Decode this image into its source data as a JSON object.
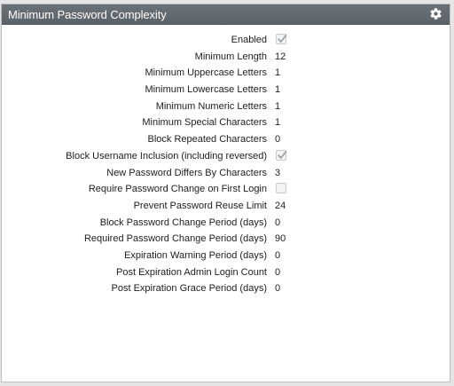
{
  "panel": {
    "title": "Minimum Password Complexity",
    "settings_icon": "gear-icon"
  },
  "settings": [
    {
      "key": "enabled",
      "label": "Enabled",
      "type": "checkbox",
      "checked": true,
      "disabled": true
    },
    {
      "key": "min-length",
      "label": "Minimum Length",
      "type": "value",
      "value": "12"
    },
    {
      "key": "min-uppercase",
      "label": "Minimum Uppercase Letters",
      "type": "value",
      "value": "1"
    },
    {
      "key": "min-lowercase",
      "label": "Minimum Lowercase Letters",
      "type": "value",
      "value": "1"
    },
    {
      "key": "min-numeric",
      "label": "Minimum Numeric Letters",
      "type": "value",
      "value": "1"
    },
    {
      "key": "min-special",
      "label": "Minimum Special Characters",
      "type": "value",
      "value": "1"
    },
    {
      "key": "block-repeated",
      "label": "Block Repeated Characters",
      "type": "value",
      "value": "0"
    },
    {
      "key": "block-username",
      "label": "Block Username Inclusion (including reversed)",
      "type": "checkbox",
      "checked": true,
      "disabled": true
    },
    {
      "key": "new-differs",
      "label": "New Password Differs By Characters",
      "type": "value",
      "value": "3"
    },
    {
      "key": "require-change-first-login",
      "label": "Require Password Change on First Login",
      "type": "checkbox",
      "checked": false,
      "disabled": true
    },
    {
      "key": "reuse-limit",
      "label": "Prevent Password Reuse Limit",
      "type": "value",
      "value": "24"
    },
    {
      "key": "block-change-period",
      "label": "Block Password Change Period (days)",
      "type": "value",
      "value": "0"
    },
    {
      "key": "required-change-period",
      "label": "Required Password Change Period (days)",
      "type": "value",
      "value": "90"
    },
    {
      "key": "expiration-warning",
      "label": "Expiration Warning Period (days)",
      "type": "value",
      "value": "0"
    },
    {
      "key": "post-expiration-admin-login",
      "label": "Post Expiration Admin Login Count",
      "type": "value",
      "value": "0"
    },
    {
      "key": "post-expiration-grace",
      "label": "Post Expiration Grace Period (days)",
      "type": "value",
      "value": "0"
    }
  ],
  "colors": {
    "header_bg": "#5f666c",
    "header_text": "#ffffff",
    "checkmark": "#9aa0a6",
    "text": "#1d1d1d"
  }
}
